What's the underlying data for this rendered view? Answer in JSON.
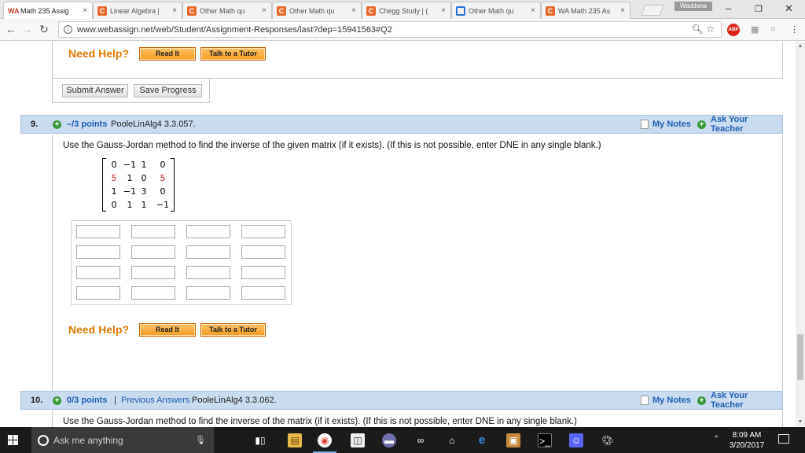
{
  "browser": {
    "tabs": [
      {
        "favicon": "WA",
        "favicon_type": "wa",
        "title": "Math 235 Assig",
        "active": true
      },
      {
        "favicon": "C",
        "favicon_type": "c",
        "title": "Linear Algebra |",
        "active": false
      },
      {
        "favicon": "C",
        "favicon_type": "c",
        "title": "Other Math qu",
        "active": false
      },
      {
        "favicon": "C",
        "favicon_type": "c",
        "title": "Other Math qu",
        "active": false
      },
      {
        "favicon": "C",
        "favicon_type": "c",
        "title": "Chegg Study | (",
        "active": false
      },
      {
        "favicon": "",
        "favicon_type": "o",
        "title": "Other Math qu",
        "active": false
      },
      {
        "favicon": "C",
        "favicon_type": "c",
        "title": "WA Math 235 As",
        "active": false
      }
    ],
    "profile_name": "Waddana",
    "url": "www.webassign.net/web/Student/Assignment-Responses/last?dep=15941563#Q2",
    "abp_label": "ABP"
  },
  "previous_question": {
    "need_help_label": "Need Help?",
    "read_it_label": "Read It",
    "talk_tutor_label": "Talk to a Tutor",
    "submit_label": "Submit Answer",
    "save_label": "Save Progress"
  },
  "question9": {
    "number": "9.",
    "points": "–/3 points",
    "reference": "PooleLinAlg4 3.3.057.",
    "my_notes": "My Notes",
    "ask_teacher": "Ask Your Teacher",
    "prompt": "Use the Gauss-Jordan method to find the inverse of the given matrix (if it exists). (If this is not possible, enter DNE in any single blank.)",
    "matrix": [
      [
        {
          "v": "0",
          "red": false
        },
        {
          "v": "−1",
          "red": false
        },
        {
          "v": "1",
          "red": false
        },
        {
          "v": "0",
          "red": false
        }
      ],
      [
        {
          "v": "5",
          "red": true
        },
        {
          "v": "1",
          "red": false
        },
        {
          "v": "0",
          "red": false
        },
        {
          "v": "5",
          "red": true
        }
      ],
      [
        {
          "v": "1",
          "red": false
        },
        {
          "v": "−1",
          "red": false
        },
        {
          "v": "3",
          "red": false
        },
        {
          "v": "0",
          "red": false
        }
      ],
      [
        {
          "v": "0",
          "red": false
        },
        {
          "v": "1",
          "red": false
        },
        {
          "v": "1",
          "red": false
        },
        {
          "v": "−1",
          "red": false
        }
      ]
    ],
    "answer_values": [
      "",
      "",
      "",
      "",
      "",
      "",
      "",
      "",
      "",
      "",
      "",
      "",
      "",
      "",
      "",
      ""
    ],
    "need_help_label": "Need Help?",
    "read_it_label": "Read It",
    "talk_tutor_label": "Talk to a Tutor"
  },
  "question10": {
    "number": "10.",
    "points": "0/3 points",
    "separator": "|",
    "previous_answers": "Previous Answers",
    "reference": "PooleLinAlg4 3.3.062.",
    "my_notes": "My Notes",
    "ask_teacher": "Ask Your Teacher",
    "prompt": "Use the Gauss-Jordan method to find the inverse of the matrix (if it exists). (If this is not possible, enter DNE in any single blank.)"
  },
  "taskbar": {
    "search_placeholder": "Ask me anything",
    "time": "8:09 AM",
    "date": "3/20/2017"
  }
}
